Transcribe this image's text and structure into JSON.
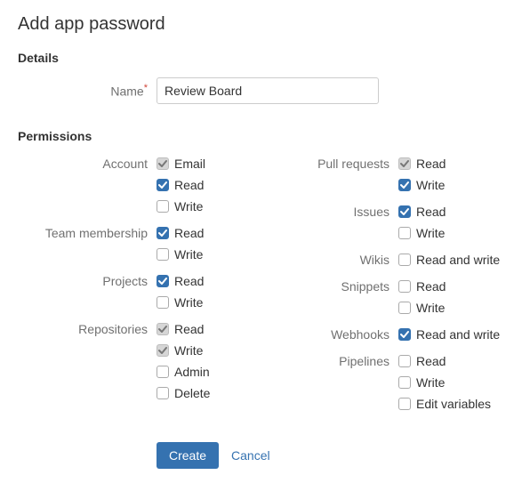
{
  "page": {
    "heading": "Add app password"
  },
  "details": {
    "section_title": "Details",
    "name_label": "Name",
    "name_value": "Review Board"
  },
  "permissions": {
    "section_title": "Permissions",
    "left": [
      {
        "label": "Account",
        "opts": [
          {
            "label": "Email",
            "checked": true,
            "disabled": true
          },
          {
            "label": "Read",
            "checked": true,
            "disabled": false
          },
          {
            "label": "Write",
            "checked": false,
            "disabled": false
          }
        ]
      },
      {
        "label": "Team membership",
        "opts": [
          {
            "label": "Read",
            "checked": true,
            "disabled": false
          },
          {
            "label": "Write",
            "checked": false,
            "disabled": false
          }
        ]
      },
      {
        "label": "Projects",
        "opts": [
          {
            "label": "Read",
            "checked": true,
            "disabled": false
          },
          {
            "label": "Write",
            "checked": false,
            "disabled": false
          }
        ]
      },
      {
        "label": "Repositories",
        "opts": [
          {
            "label": "Read",
            "checked": true,
            "disabled": true
          },
          {
            "label": "Write",
            "checked": true,
            "disabled": true
          },
          {
            "label": "Admin",
            "checked": false,
            "disabled": false
          },
          {
            "label": "Delete",
            "checked": false,
            "disabled": false
          }
        ]
      }
    ],
    "right": [
      {
        "label": "Pull requests",
        "opts": [
          {
            "label": "Read",
            "checked": true,
            "disabled": true
          },
          {
            "label": "Write",
            "checked": true,
            "disabled": false
          }
        ]
      },
      {
        "label": "Issues",
        "opts": [
          {
            "label": "Read",
            "checked": true,
            "disabled": false
          },
          {
            "label": "Write",
            "checked": false,
            "disabled": false
          }
        ]
      },
      {
        "label": "Wikis",
        "opts": [
          {
            "label": "Read and write",
            "checked": false,
            "disabled": false
          }
        ]
      },
      {
        "label": "Snippets",
        "opts": [
          {
            "label": "Read",
            "checked": false,
            "disabled": false
          },
          {
            "label": "Write",
            "checked": false,
            "disabled": false
          }
        ]
      },
      {
        "label": "Webhooks",
        "opts": [
          {
            "label": "Read and write",
            "checked": true,
            "disabled": false
          }
        ]
      },
      {
        "label": "Pipelines",
        "opts": [
          {
            "label": "Read",
            "checked": false,
            "disabled": false
          },
          {
            "label": "Write",
            "checked": false,
            "disabled": false
          },
          {
            "label": "Edit variables",
            "checked": false,
            "disabled": false
          }
        ]
      }
    ]
  },
  "buttons": {
    "create": "Create",
    "cancel": "Cancel"
  }
}
